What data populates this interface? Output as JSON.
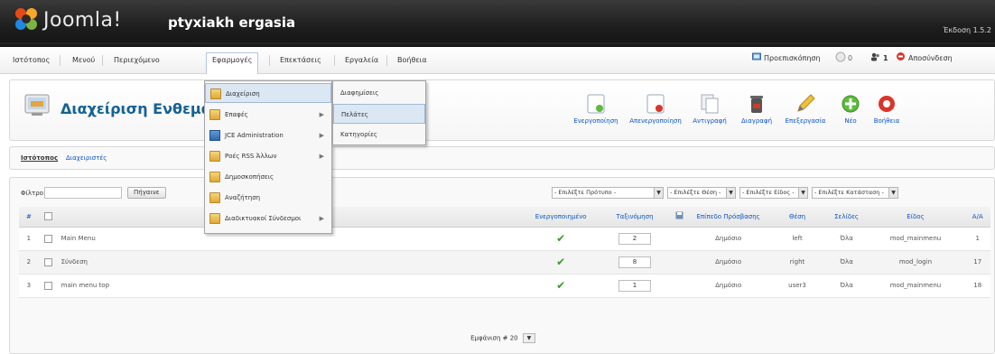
{
  "header": {
    "logo_text": "Joomla!",
    "site_name": "ptyxiakh ergasia",
    "version": "Έκδοση 1.5.2"
  },
  "menubar": {
    "items": [
      {
        "label": "Ιστότοπος"
      },
      {
        "label": "Μενού"
      },
      {
        "label": "Περιεχόμενο"
      },
      {
        "label": "Εφαρμογές"
      },
      {
        "label": "Επεκτάσεις"
      },
      {
        "label": "Εργαλεία"
      },
      {
        "label": "Βοήθεια"
      }
    ],
    "status": {
      "preview_label": "Προεπισκόπηση",
      "messages_count": "0",
      "users_count": "1",
      "logout_label": "Αποσύνδεση"
    }
  },
  "toolbar": {
    "page_title": "Διαχείριση Ενθεμάτων",
    "buttons": [
      {
        "label": "Ενεργοποίηση"
      },
      {
        "label": "Απενεργοποίηση"
      },
      {
        "label": "Αντιγραφή"
      },
      {
        "label": "Διαγραφή"
      },
      {
        "label": "Επεξεργασία"
      },
      {
        "label": "Νέο"
      },
      {
        "label": "Βοήθεια"
      }
    ]
  },
  "submenu": {
    "items": [
      {
        "label": "Ιστότοπος",
        "active": true
      },
      {
        "label": "Διαχειριστές",
        "active": false
      }
    ]
  },
  "filter": {
    "label": "Φίλτρο:",
    "value": "",
    "go_label": "Πήγαινε",
    "selects": [
      {
        "value": "- Επιλέξτε Πρότυπο -"
      },
      {
        "value": "- Επιλέξτε Θέση -"
      },
      {
        "value": "- Επιλέξτε Είδος -"
      },
      {
        "value": "- Επιλέξτε Κατάσταση -"
      }
    ]
  },
  "table": {
    "headers": {
      "num": "#",
      "enabled": "Ενεργοποιημένο",
      "order": "Ταξινόμηση",
      "access": "Επίπεδο Πρόσβασης",
      "position": "Θέση",
      "pages": "Σελίδες",
      "type": "Είδος",
      "id": "A/A"
    },
    "rows": [
      {
        "num": "1",
        "title": "Main Menu",
        "order": "2",
        "access": "Δημόσιο",
        "position": "left",
        "pages": "Όλα",
        "type": "mod_mainmenu",
        "id": "1"
      },
      {
        "num": "2",
        "title": "Σύνδεση",
        "order": "8",
        "access": "Δημόσιο",
        "position": "right",
        "pages": "Όλα",
        "type": "mod_login",
        "id": "17"
      },
      {
        "num": "3",
        "title": "main menu top",
        "order": "1",
        "access": "Δημόσιο",
        "position": "user3",
        "pages": "Όλα",
        "type": "mod_mainmenu",
        "id": "18"
      }
    ],
    "footer": {
      "display_label": "Εμφάνιση #",
      "limit": "20"
    }
  },
  "dropdown_main": {
    "items": [
      {
        "label": "Διαχείριση",
        "icon": "folder-icon",
        "has_sub": false,
        "highlight": true
      },
      {
        "label": "Επαφές",
        "icon": "folder-icon",
        "has_sub": true,
        "highlight": false
      },
      {
        "label": "JCE Administration",
        "icon": "jce-icon",
        "has_sub": true,
        "highlight": false
      },
      {
        "label": "Ροές RSS Άλλων",
        "icon": "folder-icon",
        "has_sub": true,
        "highlight": false
      },
      {
        "label": "Δημοσκοπήσεις",
        "icon": "folder-icon",
        "has_sub": false,
        "highlight": false
      },
      {
        "label": "Αναζήτηση",
        "icon": "folder-icon",
        "has_sub": false,
        "highlight": false
      },
      {
        "label": "Διαδικτυακοί Σύνδεσμοι",
        "icon": "folder-icon",
        "has_sub": true,
        "highlight": false
      }
    ]
  },
  "dropdown_sub": {
    "items": [
      {
        "label": "Διαφημίσεις",
        "highlight": false
      },
      {
        "label": "Πελάτες",
        "highlight": true
      },
      {
        "label": "Κατηγορίες",
        "highlight": false
      }
    ]
  },
  "colors": {
    "header_bg": "#1d1d1d",
    "title_blue": "#146295",
    "link_blue": "#0b55c4",
    "check_green": "#3b9b2b",
    "access_green": "#0a8a00"
  }
}
